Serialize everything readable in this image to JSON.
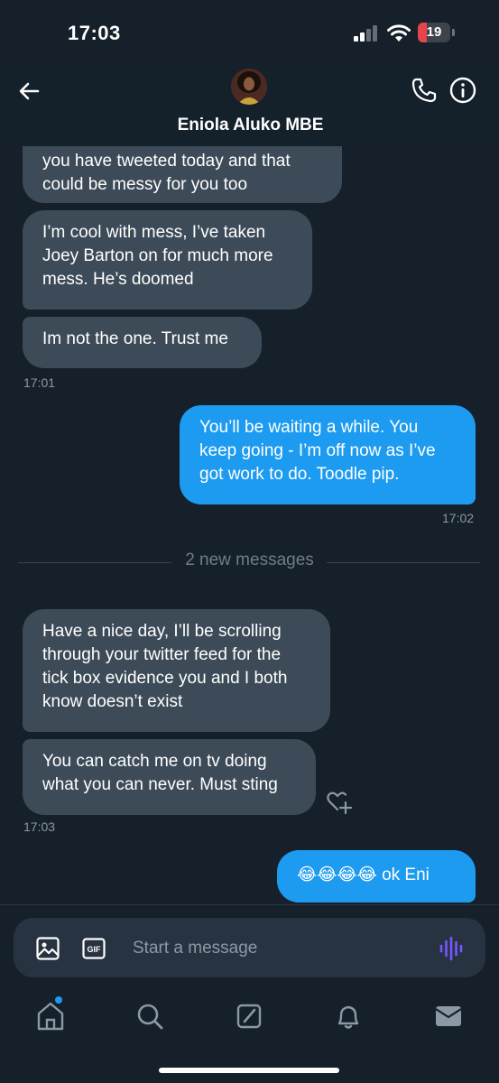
{
  "status_bar": {
    "time": "17:03",
    "battery": "19"
  },
  "header": {
    "contact_name": "Eniola Aluko MBE"
  },
  "messages": [
    {
      "id": "m1",
      "direction": "incoming",
      "text": "you have tweeted today and that could be messy for you too"
    },
    {
      "id": "m2",
      "direction": "incoming",
      "text": "I’m cool with mess, I’ve taken Joey Barton on for much more mess. He’s doomed"
    },
    {
      "id": "m3",
      "direction": "incoming",
      "text": "Im not the one. Trust me"
    },
    {
      "id": "m4",
      "direction": "outgoing",
      "text": "You’ll be waiting a while. You keep going - I’m off now as I’ve got work to do. Toodle pip."
    },
    {
      "id": "m5",
      "direction": "incoming",
      "text": "Have a nice day, I’ll be scrolling through your twitter feed for the tick box evidence you and I both know doesn’t exist"
    },
    {
      "id": "m6",
      "direction": "incoming",
      "text": "You can catch me on tv doing what you can never. Must sting"
    },
    {
      "id": "m7",
      "direction": "outgoing",
      "text": "😂😂😂😂 ok Eni"
    }
  ],
  "timestamps": {
    "t1": "17:01",
    "t2": "17:02",
    "t3": "17:03"
  },
  "divider": {
    "label": "2 new messages"
  },
  "composer": {
    "placeholder": "Start a message",
    "gif_label": "GIF"
  },
  "tabs": [
    "home",
    "search",
    "grok",
    "notifications",
    "messages"
  ],
  "colors": {
    "background": "#15202b",
    "incoming_bubble": "#3d4b58",
    "outgoing_bubble": "#1d9bf0",
    "voice_icon": "#7856ff"
  }
}
